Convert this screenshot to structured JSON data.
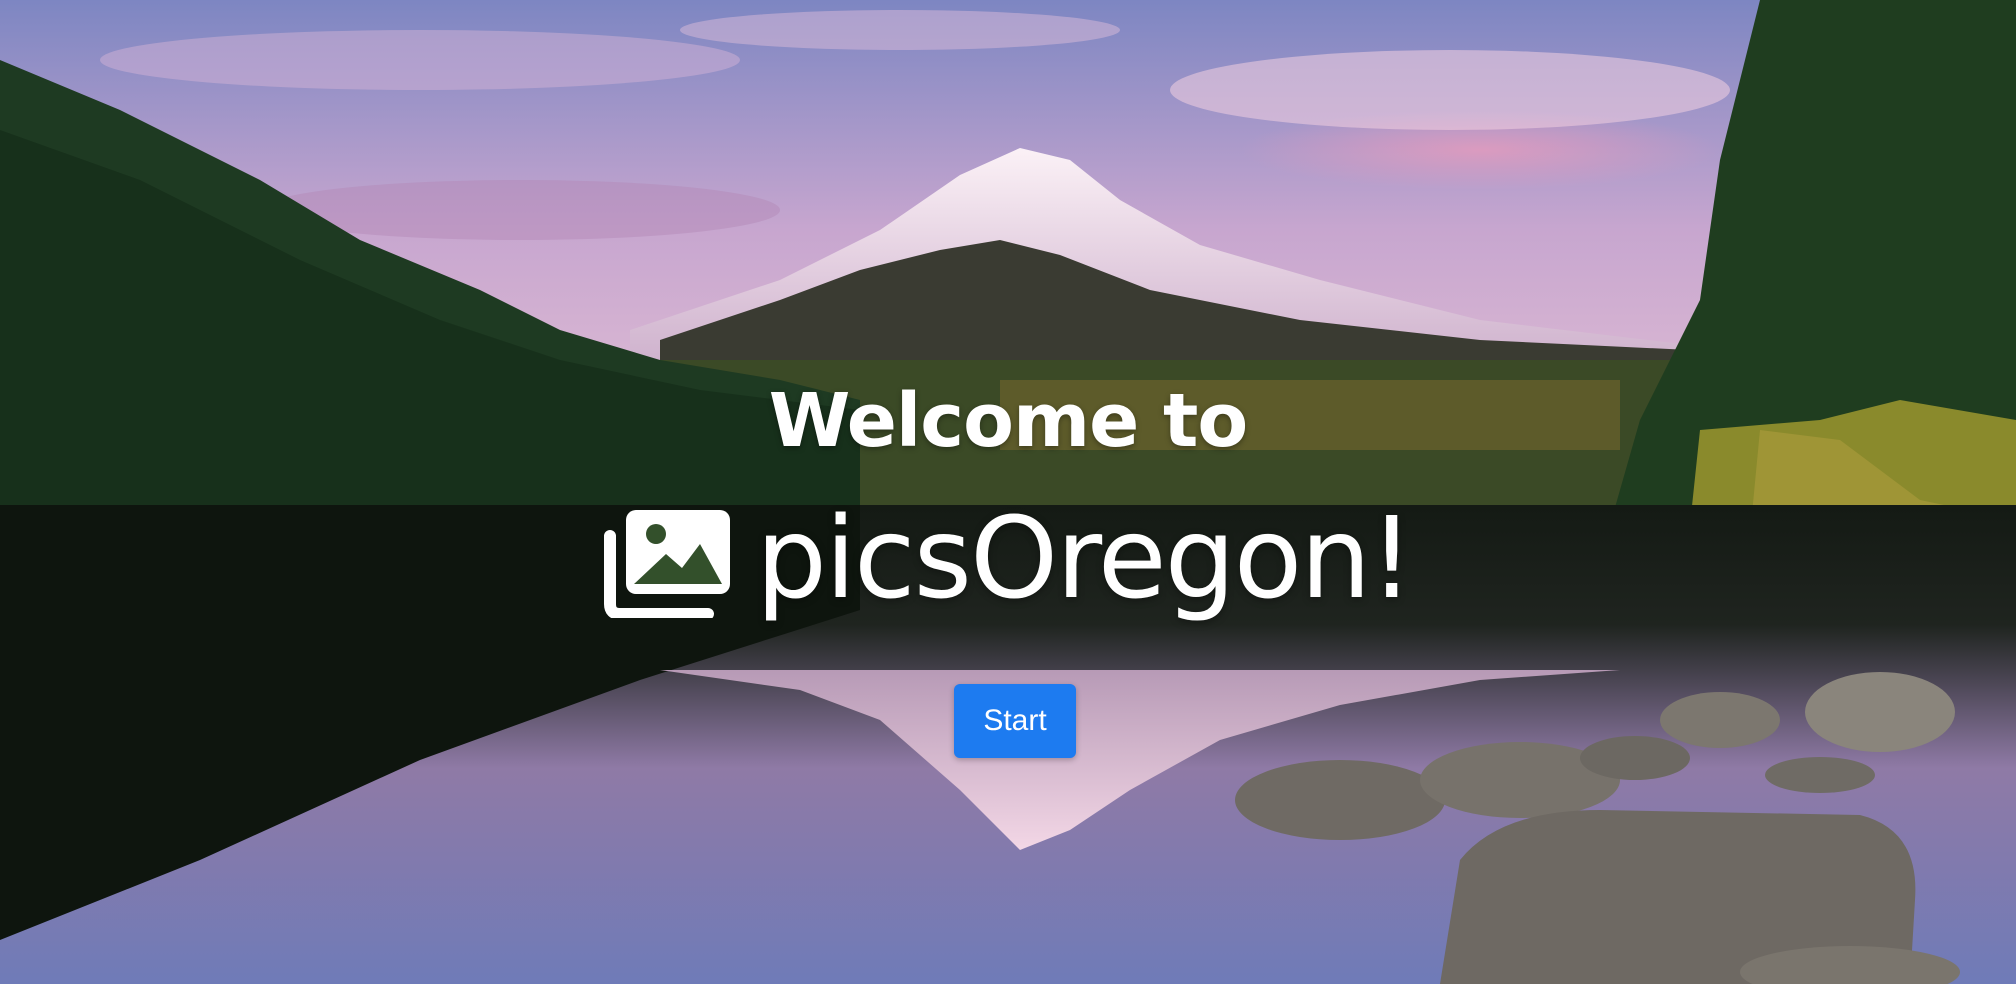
{
  "hero": {
    "welcome_text": "Welcome to",
    "brand_name": "picsOregon!",
    "brand_icon": "images-icon",
    "start_label": "Start"
  },
  "colors": {
    "button_bg": "#1d7bf0",
    "text": "#ffffff"
  }
}
